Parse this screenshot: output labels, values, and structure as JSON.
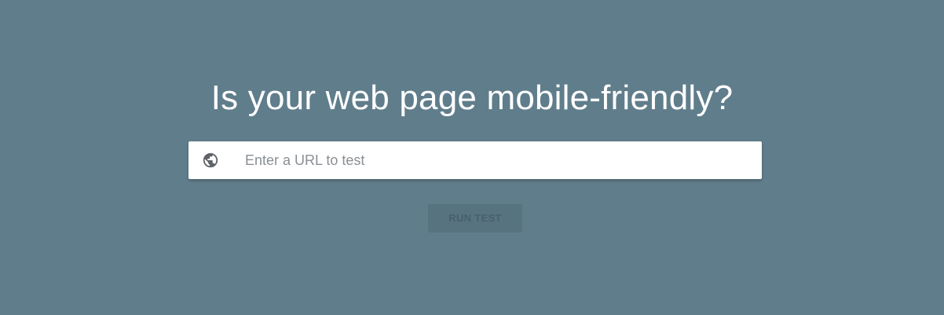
{
  "page": {
    "background_color": "#607d8b",
    "headline": "Is your web page mobile-friendly?"
  },
  "url_field": {
    "icon": "globe-icon",
    "value": "",
    "placeholder": "Enter a URL to test"
  },
  "run_button": {
    "label": "RUN TEST",
    "state": "disabled"
  }
}
